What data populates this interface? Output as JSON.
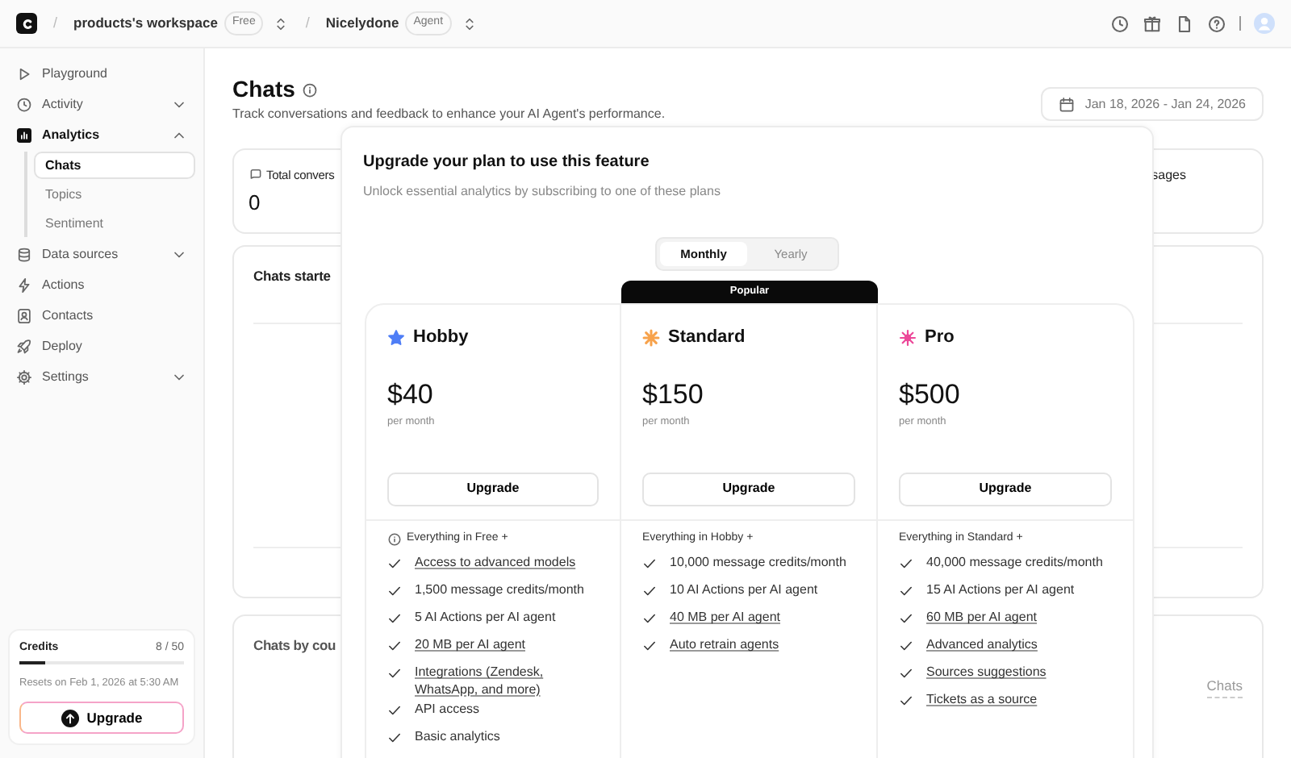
{
  "topbar": {
    "crumbs": [
      {
        "separator": "/",
        "name": "products's workspace",
        "badge": "Free"
      },
      {
        "separator": "/",
        "name": "Nicelydone",
        "badge": "Agent"
      }
    ]
  },
  "sidebar": {
    "items": [
      {
        "label": "Playground",
        "selected": false
      },
      {
        "label": "Activity",
        "selected": false,
        "expanded": false
      },
      {
        "label": "Analytics",
        "selected": true,
        "expanded": true,
        "children": [
          {
            "label": "Chats",
            "selected": true
          },
          {
            "label": "Topics",
            "selected": false
          },
          {
            "label": "Sentiment",
            "selected": false
          }
        ]
      },
      {
        "label": "Data sources",
        "selected": false,
        "expanded": false
      },
      {
        "label": "Actions",
        "selected": false
      },
      {
        "label": "Contacts",
        "selected": false
      },
      {
        "label": "Deploy",
        "selected": false
      },
      {
        "label": "Settings",
        "selected": false,
        "expanded": false
      }
    ],
    "credits": {
      "label": "Credits",
      "value": "8 / 50",
      "level": 0.16,
      "note": "Resets on Feb 1, 2026 at 5:30 AM",
      "button": "Upgrade"
    }
  },
  "page": {
    "title": "Chats",
    "subtitle": "Track conversations and feedback to enhance your AI Agent's performance.",
    "date_range": "Jan 18, 2026 - Jan 24, 2026",
    "stats": [
      {
        "label": "Total convers",
        "value": "0"
      },
      {
        "label": "sages"
      }
    ],
    "panels": [
      {
        "title": "Chats starte"
      },
      {
        "title": "Chats by cou",
        "legend": "Chats"
      }
    ]
  },
  "modal": {
    "title": "Upgrade your plan to use this feature",
    "subtitle": "Unlock essential analytics by subscribing to one of these plans",
    "billing": [
      {
        "label": "Monthly",
        "selected": true
      },
      {
        "label": "Yearly",
        "selected": false
      }
    ],
    "plans": [
      {
        "name": "Hobby",
        "color": "#4f7ef6",
        "price": "$40",
        "period": "per month",
        "button": "Upgrade",
        "info": true,
        "heading": "Everything in Free +",
        "features": [
          {
            "text": "Access to advanced models",
            "linked": true
          },
          {
            "text": "1,500 message credits/month",
            "linked": false
          },
          {
            "text": "5 AI Actions per AI agent",
            "linked": false
          },
          {
            "text": "20 MB per AI agent",
            "linked": true
          },
          {
            "text": "Integrations (Zendesk, WhatsApp, and more)",
            "linked": true
          },
          {
            "text": "API access",
            "linked": false
          },
          {
            "text": "Basic analytics",
            "linked": false
          }
        ]
      },
      {
        "name": "Standard",
        "color": "#f7a24b",
        "badge": "Popular",
        "price": "$150",
        "period": "per month",
        "button": "Upgrade",
        "info": false,
        "heading": "Everything in Hobby +",
        "features": [
          {
            "text": "10,000 message credits/month",
            "linked": false
          },
          {
            "text": "10 AI Actions per AI agent",
            "linked": false
          },
          {
            "text": "40 MB per AI agent",
            "linked": true
          },
          {
            "text": "Auto retrain agents",
            "linked": true
          }
        ]
      },
      {
        "name": "Pro",
        "color": "#ec4899",
        "price": "$500",
        "period": "per month",
        "button": "Upgrade",
        "info": false,
        "heading": "Everything in Standard +",
        "features": [
          {
            "text": "40,000 message credits/month",
            "linked": false
          },
          {
            "text": "15 AI Actions per AI agent",
            "linked": false
          },
          {
            "text": "60 MB per AI agent",
            "linked": true
          },
          {
            "text": "Advanced analytics",
            "linked": true
          },
          {
            "text": "Sources suggestions",
            "linked": true
          },
          {
            "text": "Tickets as a source",
            "linked": true
          }
        ]
      }
    ]
  }
}
